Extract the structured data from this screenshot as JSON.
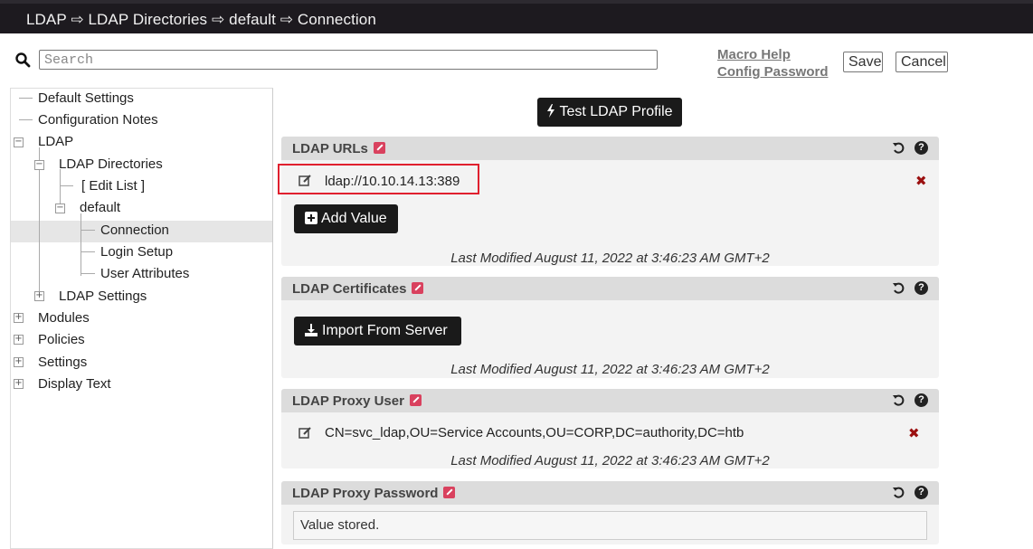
{
  "header": {
    "breadcrumb": "LDAP ⇨ LDAP Directories ⇨ default ⇨ Connection"
  },
  "search": {
    "placeholder": "Search",
    "value": ""
  },
  "links": {
    "macro_help": "Macro Help",
    "config_password": "Config Password"
  },
  "buttons": {
    "save": "Save",
    "cancel": "Cancel",
    "test_ldap": "Test LDAP Profile",
    "add_value": "Add Value",
    "import_server": "Import From Server"
  },
  "tree": {
    "default_settings": "Default Settings",
    "configuration_notes": "Configuration Notes",
    "ldap": "LDAP",
    "ldap_directories": "LDAP Directories",
    "edit_list": "[ Edit List ]",
    "default": "default",
    "connection": "Connection",
    "login_setup": "Login Setup",
    "user_attributes": "User Attributes",
    "ldap_settings": "LDAP Settings",
    "modules": "Modules",
    "policies": "Policies",
    "settings": "Settings",
    "display_text": "Display Text"
  },
  "panels": {
    "urls": {
      "title": "LDAP URLs",
      "value": "ldap://10.10.14.13:389",
      "modified": "Last Modified August 11, 2022 at 3:46:23 AM GMT+2"
    },
    "certs": {
      "title": "LDAP Certificates",
      "modified": "Last Modified August 11, 2022 at 3:46:23 AM GMT+2"
    },
    "proxy_user": {
      "title": "LDAP Proxy User",
      "value": "CN=svc_ldap,OU=Service Accounts,OU=CORP,DC=authority,DC=htb",
      "modified": "Last Modified August 11, 2022 at 3:46:23 AM GMT+2"
    },
    "proxy_password": {
      "title": "LDAP Proxy Password",
      "value": "Value stored."
    }
  },
  "icons": {
    "search": "search-icon",
    "undo": "undo-icon",
    "help": "help-icon",
    "edit": "edit-icon",
    "delete": "delete-icon",
    "plus": "plus-icon",
    "download": "download-icon",
    "bolt": "bolt-icon"
  },
  "colors": {
    "header_bg": "#1d1a1f",
    "highlight": "#e0202e",
    "edit_badge": "#d9415e",
    "delete": "#9b1010"
  }
}
